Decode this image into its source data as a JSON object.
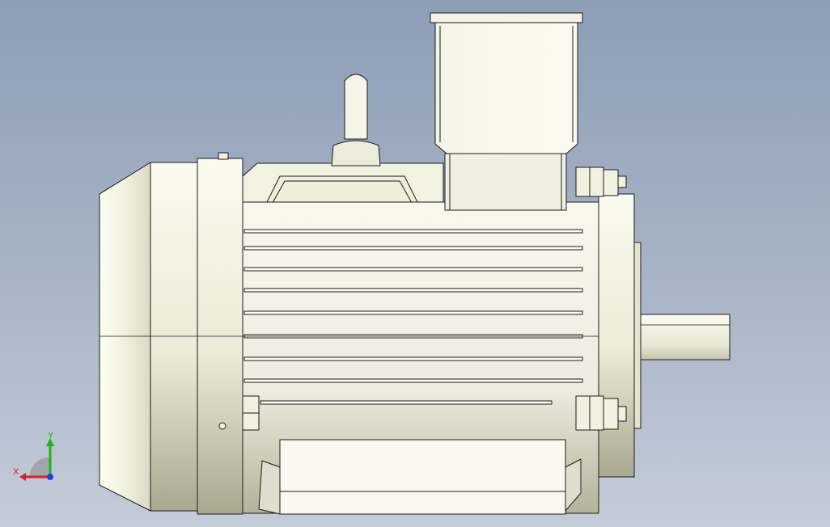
{
  "viewport": {
    "background_top": "#8e9db6",
    "background_bottom": "#c4ccd8",
    "model": "electric-motor-side-view"
  },
  "colors": {
    "body_light": "#f7f7ea",
    "body_mid": "#e9e9d6",
    "body_shade": "#b9b9a1",
    "edge": "#1b1b1b"
  },
  "triad": {
    "x_label": "X",
    "y_label": "Y",
    "x_color": "#e02020",
    "y_color": "#18b818",
    "z_color": "#2040e0"
  }
}
